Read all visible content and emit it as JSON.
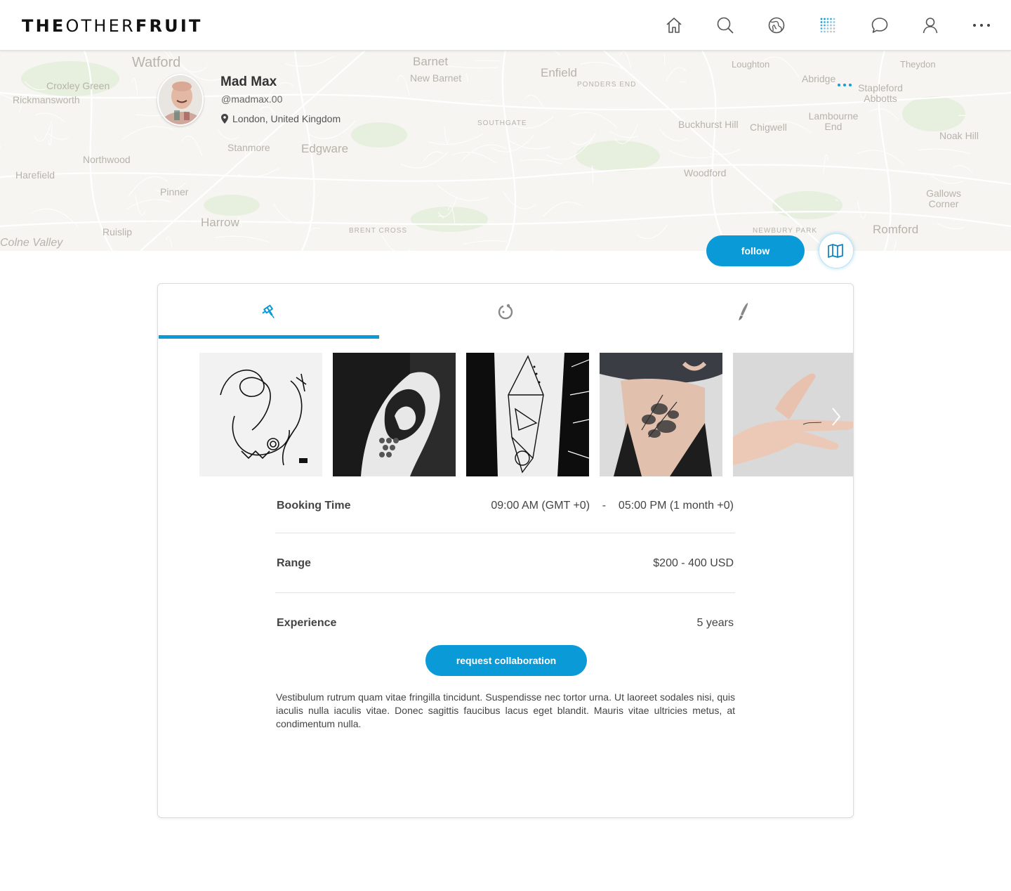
{
  "header": {
    "logo": {
      "part1": "THE",
      "part2": "OTHER",
      "part3": "FRUIT"
    },
    "nav_icons": [
      "home-icon",
      "search-icon",
      "globe-icon",
      "grid-dots-icon",
      "chat-icon",
      "user-icon",
      "more-icon"
    ],
    "accent": "#0b9ad8"
  },
  "map": {
    "labels": [
      "Watford",
      "Barnet",
      "New Barnet",
      "Enfield",
      "Loughton",
      "Abridge",
      "Theydon",
      "Croxley Green",
      "Rickmansworth",
      "Stapleford Abbotts",
      "Ponders End",
      "Southgate",
      "Buckhurst Hill",
      "Chigwell",
      "Lambourne End",
      "Noak Hill",
      "Stanmore",
      "Edgware",
      "Northwood",
      "Harefield",
      "Pinner",
      "Woodford",
      "Gallows Corner",
      "Harrow",
      "Ruislip",
      "Brent Cross",
      "Newbury Park",
      "Romford",
      "Colne Valley"
    ]
  },
  "profile": {
    "name": "Mad Max",
    "handle": "@madmax.00",
    "location": "London, United Kingdom",
    "follow_label": "follow"
  },
  "tabs": [
    {
      "icon": "tattoo-machine-icon",
      "active": true
    },
    {
      "icon": "piercing-ring-icon",
      "active": false
    },
    {
      "icon": "brush-icon",
      "active": false
    }
  ],
  "gallery": {
    "items": [
      {
        "alt": "line art tattoo sketch"
      },
      {
        "alt": "shoulder tattoo black and white"
      },
      {
        "alt": "geometric forearm tattoo"
      },
      {
        "alt": "floral hip tattoo"
      },
      {
        "alt": "hand finger script tattoo"
      }
    ]
  },
  "details": {
    "booking_label": "Booking Time",
    "booking_value": "09:00 AM (GMT +0)    -    05:00 PM (1 month +0)",
    "range_label": "Range",
    "range_value": "$200 - 400 USD",
    "experience_label": "Experience",
    "experience_value": "5 years"
  },
  "collab_label": "request collaboration",
  "description": "Vestibulum rutrum quam vitae fringilla tincidunt. Suspendisse nec tortor urna. Ut laoreet sodales nisi, quis iaculis nulla iaculis vitae. Donec sagittis faucibus lacus eget blandit. Mauris vitae ultricies metus, at condimentum nulla."
}
